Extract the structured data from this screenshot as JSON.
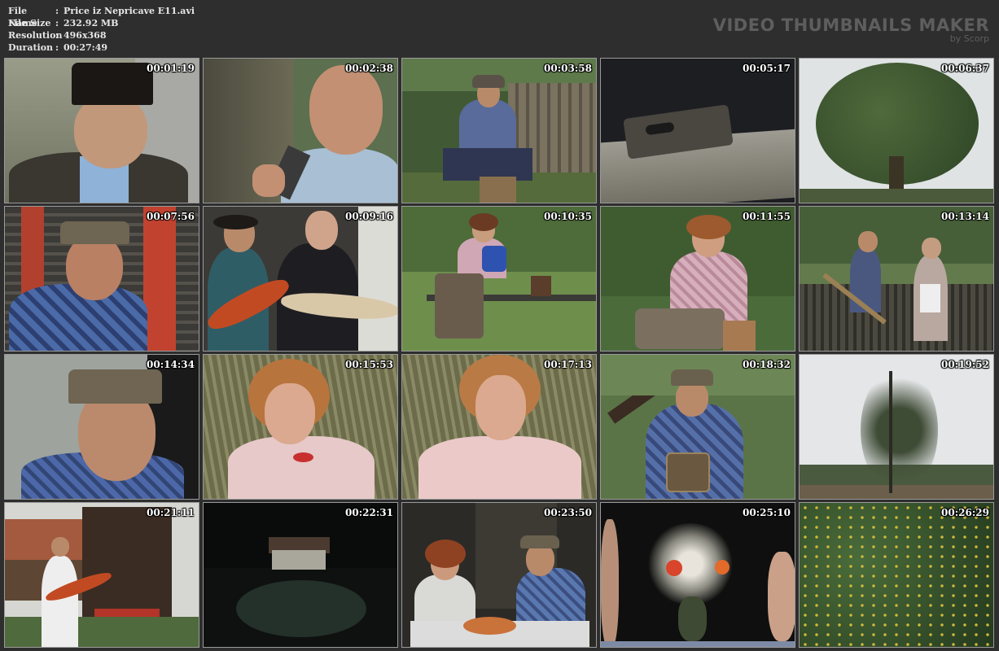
{
  "info": {
    "file_name_label": "File Name",
    "file_name": "Price iz Nepricave E11.avi",
    "file_size_label": "File Size",
    "file_size": "232.92 MB",
    "resolution_label": "Resolution",
    "resolution": "496x368",
    "duration_label": "Duration",
    "duration": "00:27:49",
    "separator": ":"
  },
  "brand": {
    "title": "VIDEO THUMBNAILS MAKER",
    "subtitle": "by Scorp"
  },
  "thumbnails": [
    {
      "time": "00:01:19"
    },
    {
      "time": "00:02:38"
    },
    {
      "time": "00:03:58"
    },
    {
      "time": "00:05:17"
    },
    {
      "time": "00:06:37"
    },
    {
      "time": "00:07:56"
    },
    {
      "time": "00:09:16"
    },
    {
      "time": "00:10:35"
    },
    {
      "time": "00:11:55"
    },
    {
      "time": "00:13:14"
    },
    {
      "time": "00:14:34"
    },
    {
      "time": "00:15:53"
    },
    {
      "time": "00:17:13"
    },
    {
      "time": "00:18:32"
    },
    {
      "time": "00:19:52"
    },
    {
      "time": "00:21:11"
    },
    {
      "time": "00:22:31"
    },
    {
      "time": "00:23:50"
    },
    {
      "time": "00:25:10"
    },
    {
      "time": "00:26:29"
    }
  ]
}
